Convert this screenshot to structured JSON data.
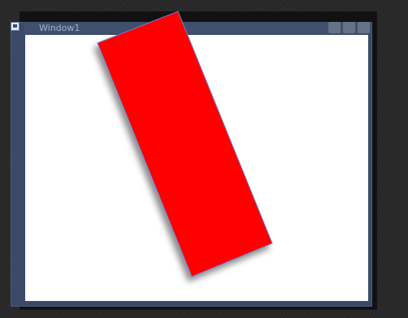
{
  "window": {
    "title": "Window1"
  },
  "shape": {
    "fill": "#ff0000",
    "stroke": "#6b7fd1"
  },
  "theme": {
    "client_background": "#ffffff",
    "window_frame": "#3a4a66"
  }
}
